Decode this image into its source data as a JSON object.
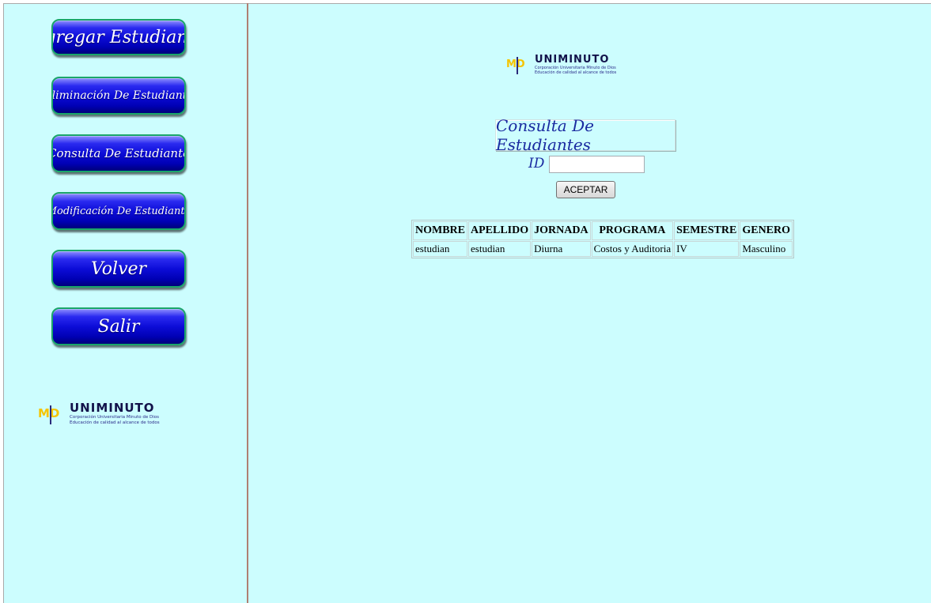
{
  "sidebar": {
    "buttons": [
      {
        "label": "Agregar Estudiante"
      },
      {
        "label": "Eliminación De Estudiante"
      },
      {
        "label": "Consulta De Estudiante"
      },
      {
        "label": "Modificación De Estudiante"
      },
      {
        "label": "Volver"
      },
      {
        "label": "Salir"
      }
    ],
    "logo": {
      "brand": "UNIMINUTO",
      "line1": "Corporación Universitaria Minuto de Dios",
      "line2": "Educación de calidad al alcance de todos",
      "mark": "MD"
    }
  },
  "main": {
    "logo": {
      "brand": "UNIMINUTO",
      "line1": "Corporación Universitaria Minuto de Dios",
      "line2": "Educación de calidad al alcance de todos",
      "mark": "MD"
    },
    "form_title": "Consulta De Estudiantes",
    "id_label": "ID",
    "id_value": "",
    "accept_label": "ACEPTAR",
    "table": {
      "headers": [
        "NOMBRE",
        "APELLIDO",
        "JORNADA",
        "PROGRAMA",
        "SEMESTRE",
        "GENERO"
      ],
      "rows": [
        [
          "estudian",
          "estudian",
          "Diurna",
          "Costos y Auditoria",
          "IV",
          "Masculino"
        ]
      ]
    }
  },
  "colors": {
    "background": "#ccfdfe",
    "button_blue": "#0d0dd8",
    "button_border": "#1aa66a",
    "title_blue": "#1a2aa0",
    "divider": "#b07f72"
  }
}
